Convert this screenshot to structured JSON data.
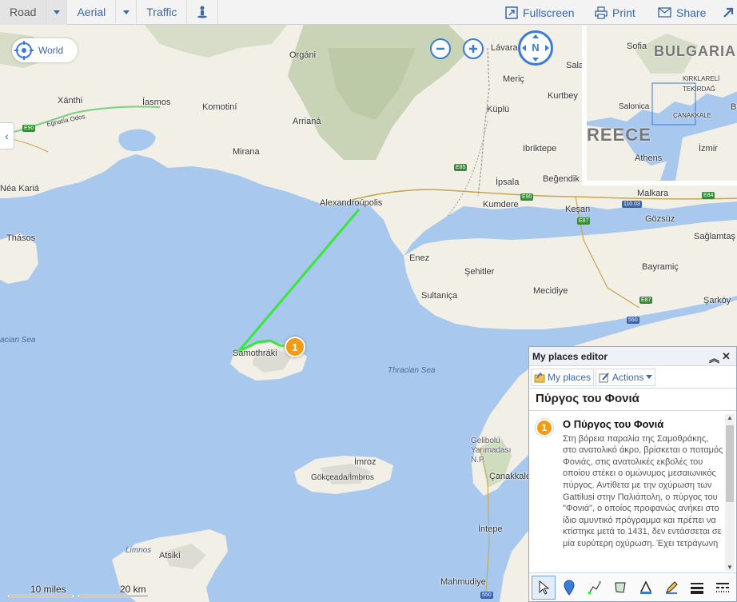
{
  "toolbar": {
    "road": "Road",
    "aerial": "Aerial",
    "traffic": "Traffic",
    "fullscreen": "Fullscreen",
    "print": "Print",
    "share": "Share"
  },
  "nav": {
    "world": "World",
    "compass": "N"
  },
  "map_labels": {
    "xanthi": "Xánthi",
    "iasmos": "Íasmos",
    "komotini": "Komotiní",
    "organi": "Orgáni",
    "arriana": "Arrianá",
    "mirana": "Mirana",
    "nea_karia": "Néa Kariá",
    "thasos": "Thásos",
    "egnatia": "Egnatía Odos",
    "alexandroupolis": "Alexandroúpolis",
    "lavara": "Lávara",
    "salа": "Sala",
    "meric": "Meriç",
    "kuplu": "Küplü",
    "kurtbey": "Kurtbey",
    "ibriktepe": "Ibriktepe",
    "begendik": "Beğendik",
    "ipsala": "İpsala",
    "kumdere": "Kumdere",
    "kesan": "Keşan",
    "malkara": "Malkara",
    "gozsuz": "Gözsüz",
    "saglamtas": "Sağlamtaş",
    "bayramic": "Bayramiç",
    "sarkoy": "Şarköy",
    "enez": "Enez",
    "sehitler": "Şehitler",
    "sultanica": "Sultaniça",
    "mecidiye": "Mecidiye",
    "samothraki": "Samothráki",
    "thracian_sea_left": "acian Sea",
    "thracian_sea": "Thracian Sea",
    "gelibolu": "Gelibolu Yarımadası N.P.",
    "imroz": "İmroz",
    "gokceada": "Gökçeada/İmbros",
    "canakkale": "Çanakkale",
    "intepe": "İntepe",
    "limnos": "Limnos",
    "atsiki": "Atsikí",
    "mahmudiye": "Mahmudiye"
  },
  "road_shields": [
    "E90",
    "E85",
    "E90",
    "110.03",
    "E87",
    "E84",
    "E87",
    "550",
    "550"
  ],
  "minimap": {
    "sofia": "Sofia",
    "bulgaria": "BULGARIA",
    "kirklareli": "KIRKLARELİ",
    "tekirdag": "TEKİRDAĞ",
    "salonica": "Salonica",
    "canakkale": "ÇANAKKALE",
    "greece": "REECE",
    "izmir": "İzmir",
    "athens": "Athens",
    "bu": "Bu"
  },
  "scale": {
    "miles": "10 miles",
    "km": "20 km"
  },
  "pin_marker": "1",
  "editor": {
    "header": "My places editor",
    "my_places": "My places",
    "actions": "Actions",
    "title": "Πύργος του Φονιά",
    "pin_number": "1",
    "place_title": "Ο Πύργος του Φονιά",
    "description": "Στη βόρεια παραλία της Σαμοθράκης, στο ανατολικό άκρο, βρίσκεται ο ποταμός Φονιάς, στις ανατολικές εκβολές του οποίου στέκει ο ομώνυμος μεσαιωνικός πύργος. Αντίθετα με την οχύρωση των Gattilusi στην Παλιάπολη, ο πύργος του \"Φονιά\", ο οποίος προφανώς ανήκει στο ίδιο αμυντικό πρόγραμμα και πρέπει να κτίστηκε μετά το 1431, δεν εντάσσεται σε μία ευρύτερη οχύρωση. Έχει τετράγωνη"
  },
  "colors": {
    "water": "#a9c8ee",
    "land": "#f2efe6",
    "route": "#3ae63a",
    "accent": "#3a7bd5",
    "pin": "#f29b15"
  }
}
